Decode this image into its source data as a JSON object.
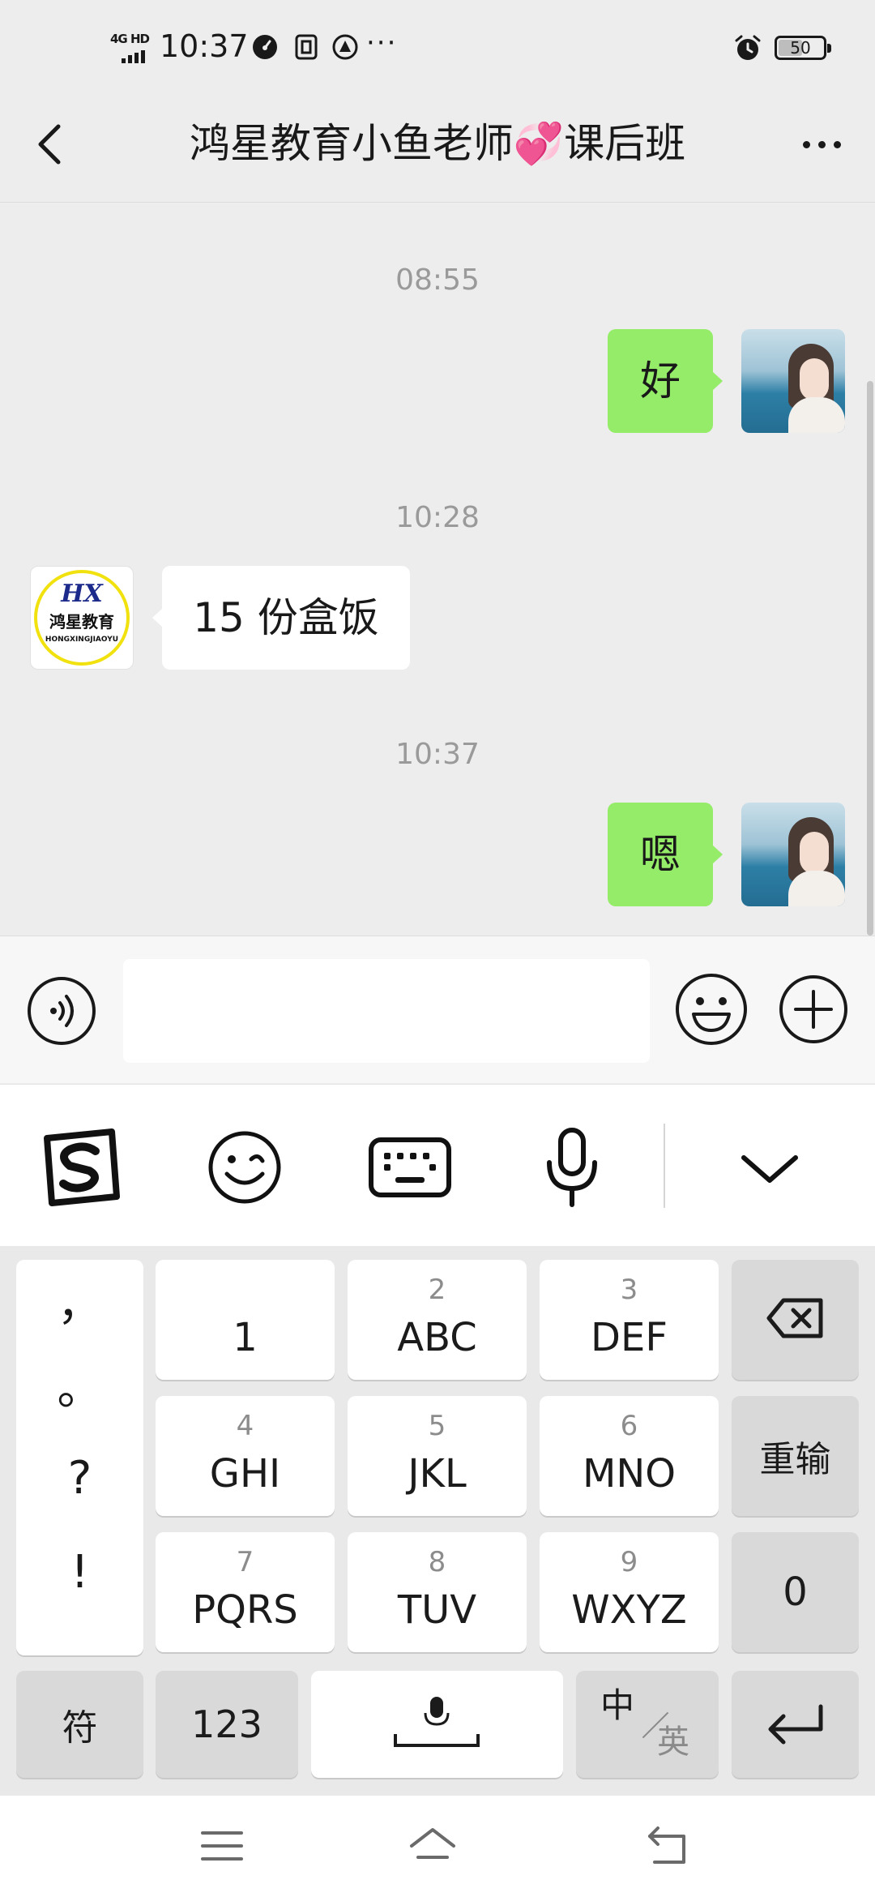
{
  "status_bar": {
    "network": "4G HD",
    "time": "10:37",
    "icons": [
      "speedometer-icon",
      "sim-icon",
      "notification-icon",
      "more-dots-icon",
      "alarm-icon"
    ],
    "battery": "50",
    "more": "···"
  },
  "header": {
    "title": "鸿星教育小鱼老师💞课后班"
  },
  "messages": [
    {
      "type": "timestamp",
      "text": "08:55"
    },
    {
      "type": "message",
      "side": "right",
      "sender": "me",
      "text": "好"
    },
    {
      "type": "timestamp",
      "text": "10:28"
    },
    {
      "type": "message",
      "side": "left",
      "sender": "鸿星教育",
      "text": "15 份盒饭"
    },
    {
      "type": "timestamp",
      "text": "10:37"
    },
    {
      "type": "message",
      "side": "right",
      "sender": "me",
      "text": "嗯"
    }
  ],
  "school_avatar": {
    "logo_letters": "HX",
    "logo_cn": "鸿星教育",
    "logo_en": "HONGXINGJIAOYU"
  },
  "input_bar": {
    "value": "",
    "icons": [
      "voice-icon",
      "emoji-icon",
      "plus-icon"
    ]
  },
  "ime_toolbar": {
    "icons": [
      "sogou-logo-icon",
      "emoji-icon",
      "keyboard-icon",
      "microphone-icon",
      "chevron-down-icon"
    ]
  },
  "keyboard": {
    "punctuation": [
      "，",
      "。",
      "?",
      "!"
    ],
    "keys": [
      {
        "num": "",
        "main": "1"
      },
      {
        "num": "2",
        "main": "ABC"
      },
      {
        "num": "3",
        "main": "DEF"
      },
      {
        "num": "4",
        "main": "GHI"
      },
      {
        "num": "5",
        "main": "JKL"
      },
      {
        "num": "6",
        "main": "MNO"
      },
      {
        "num": "7",
        "main": "PQRS"
      },
      {
        "num": "8",
        "main": "TUV"
      },
      {
        "num": "9",
        "main": "WXYZ"
      }
    ],
    "reinput": "重输",
    "zero": "0",
    "symbol": "符",
    "numeric": "123",
    "zh": "中",
    "en": "英"
  },
  "colors": {
    "bubble_me": "#95ec69",
    "bubble_them": "#ffffff",
    "background": "#ededed"
  }
}
